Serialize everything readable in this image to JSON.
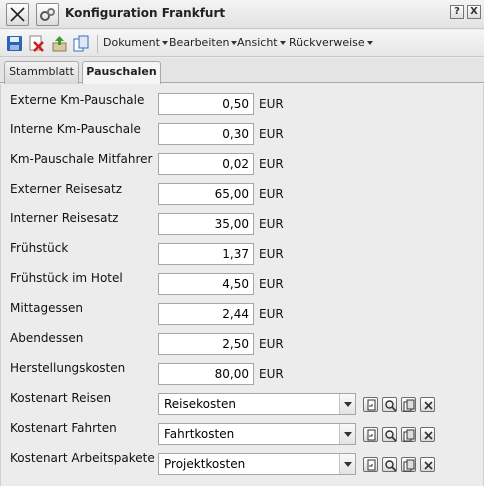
{
  "window": {
    "title": "Konfiguration Frankfurt",
    "help_label": "?",
    "close_label": "X"
  },
  "menu": {
    "dokument": "Dokument",
    "bearbeiten": "Bearbeiten",
    "ansicht": "Ansicht",
    "rueckverweise": "Rückverweise"
  },
  "tabs": [
    {
      "label": "Stammblatt",
      "active": false
    },
    {
      "label": "Pauschalen",
      "active": true
    }
  ],
  "fields": [
    {
      "label": "Externe Km-Pauschale",
      "value": "0,50",
      "unit": "EUR"
    },
    {
      "label": "Interne Km-Pauschale",
      "value": "0,30",
      "unit": "EUR"
    },
    {
      "label": "Km-Pauschale Mitfahrer",
      "value": "0,02",
      "unit": "EUR"
    },
    {
      "label": "Externer Reisesatz",
      "value": "65,00",
      "unit": "EUR"
    },
    {
      "label": "Interner Reisesatz",
      "value": "35,00",
      "unit": "EUR"
    },
    {
      "label": "Frühstück",
      "value": "1,37",
      "unit": "EUR"
    },
    {
      "label": "Frühstück im Hotel",
      "value": "4,50",
      "unit": "EUR"
    },
    {
      "label": "Mittagessen",
      "value": "2,44",
      "unit": "EUR"
    },
    {
      "label": "Abendessen",
      "value": "2,50",
      "unit": "EUR"
    },
    {
      "label": "Herstellungskosten",
      "value": "80,00",
      "unit": "EUR"
    }
  ],
  "cost_types": [
    {
      "label": "Kostenart Reisen",
      "value": "Reisekosten"
    },
    {
      "label": "Kostenart Fahrten",
      "value": "Fahrtkosten"
    },
    {
      "label": "Kostenart Arbeitspakete",
      "value": "Projektkosten"
    }
  ],
  "icons": {
    "toolbar": [
      "save-icon",
      "delete-document-icon",
      "export-icon",
      "copy-icon"
    ],
    "cost_type_actions": [
      "open-icon",
      "search-icon",
      "copy-icon",
      "clear-icon"
    ]
  },
  "colors": {
    "background": "#ececec",
    "save_blue": "#2a63b8",
    "delete_red": "#c8201c",
    "export_green": "#3f9a2a"
  }
}
